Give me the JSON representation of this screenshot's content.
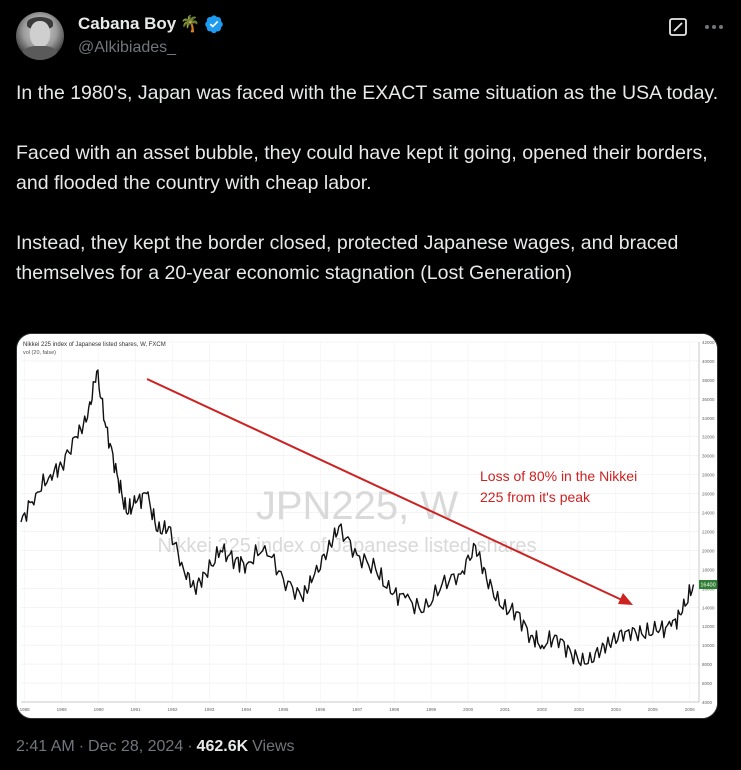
{
  "author": {
    "display_name": "Cabana Boy",
    "emoji": "🌴",
    "handle": "@Alkibiades_"
  },
  "tweet": {
    "paragraphs": [
      "In the 1980's, Japan was faced with the EXACT same situation as the USA today.",
      "Faced with an asset bubble, they could have kept it going, opened their borders, and flooded the country with cheap labor.",
      "Instead, they kept the border closed, protected Japanese wages, and braced themselves for a 20-year economic stagnation (Lost Generation)"
    ]
  },
  "footer": {
    "time": "2:41 AM",
    "sep1": "·",
    "date": "Dec 28, 2024",
    "sep2": "·",
    "views_count": "462.6K",
    "views_label": "Views"
  },
  "media": {
    "chart_title": "Nikkei 225 index of Japanese listed shares, W, FXCM",
    "chart_subtitle": "vol (20, false)",
    "watermark_symbol": "JPN225, W",
    "watermark_desc": "Nikkei 225 index of Japanese listed shares",
    "annotation_line1": "Loss of 80% in the Nikkei",
    "annotation_line2": "225 from it's peak",
    "price_label": "16400",
    "colors": {
      "line": "#111111",
      "arrow": "#cc2222",
      "annotation": "#cc2222",
      "accent": "#1d9bf0"
    },
    "chart_data": {
      "type": "line",
      "x_ticks": [
        "1988",
        "1989",
        "1990",
        "1991",
        "1992",
        "1993",
        "1994",
        "1995",
        "1996",
        "1997",
        "1998",
        "1999",
        "2000",
        "2001",
        "2002",
        "2003",
        "2004",
        "2005",
        "2006"
      ],
      "y_ticks": [
        4000,
        6000,
        8000,
        10000,
        12000,
        14000,
        16000,
        18000,
        20000,
        22000,
        24000,
        26000,
        28000,
        30000,
        32000,
        34000,
        36000,
        38000,
        40000,
        42000
      ],
      "ylim": [
        4000,
        42000
      ],
      "x": [
        1987.9,
        1988.3,
        1988.7,
        1989.0,
        1989.4,
        1989.7,
        1989.95,
        1990.2,
        1990.5,
        1990.75,
        1991.0,
        1991.3,
        1991.6,
        1991.9,
        1992.3,
        1992.6,
        1992.9,
        1993.3,
        1993.7,
        1994.0,
        1994.5,
        1995.0,
        1995.5,
        1995.8,
        1996.2,
        1996.5,
        1997.0,
        1997.5,
        1997.9,
        1998.3,
        1998.8,
        1999.3,
        1999.8,
        2000.2,
        2000.5,
        2000.9,
        2001.3,
        2001.7,
        2002.0,
        2002.4,
        2002.8,
        2003.2,
        2003.6,
        2003.9,
        2004.3,
        2004.7,
        2005.1,
        2005.5,
        2005.8,
        2006.1
      ],
      "y": [
        23000,
        26000,
        28000,
        29000,
        32000,
        34000,
        38900,
        33000,
        28000,
        24000,
        25000,
        26000,
        22000,
        22500,
        18000,
        16000,
        17500,
        20000,
        19000,
        18500,
        20500,
        17000,
        15000,
        17000,
        20000,
        22500,
        19500,
        18000,
        15500,
        15000,
        13500,
        16500,
        17500,
        20500,
        17000,
        14000,
        13500,
        11000,
        10000,
        11000,
        9000,
        8000,
        9500,
        10500,
        11500,
        11200,
        11500,
        12000,
        13500,
        16400
      ],
      "annotations": [
        "Loss of 80% in the Nikkei 225 from it's peak"
      ]
    }
  }
}
